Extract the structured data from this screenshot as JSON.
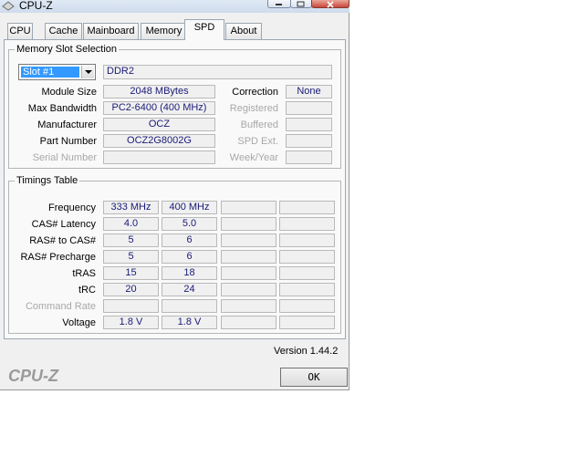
{
  "window": {
    "title": "CPU-Z"
  },
  "tabs": [
    "CPU",
    "Cache",
    "Mainboard",
    "Memory",
    "SPD",
    "About"
  ],
  "active_tab": "SPD",
  "slot": {
    "group_title": "Memory Slot Selection",
    "selected": "Slot #1",
    "type": "DDR2",
    "module_size_label": "Module Size",
    "module_size": "2048 MBytes",
    "max_bandwidth_label": "Max Bandwidth",
    "max_bandwidth": "PC2-6400 (400 MHz)",
    "manufacturer_label": "Manufacturer",
    "manufacturer": "OCZ",
    "part_number_label": "Part Number",
    "part_number": "OCZ2G8002G",
    "serial_number_label": "Serial Number",
    "serial_number": "",
    "correction_label": "Correction",
    "correction": "None",
    "registered_label": "Registered",
    "registered": "",
    "buffered_label": "Buffered",
    "buffered": "",
    "spd_ext_label": "SPD Ext.",
    "spd_ext": "",
    "week_year_label": "Week/Year",
    "week_year": ""
  },
  "timings": {
    "group_title": "Timings Table",
    "rows": [
      {
        "label": "Frequency",
        "values": [
          "333 MHz",
          "400 MHz",
          "",
          ""
        ]
      },
      {
        "label": "CAS# Latency",
        "values": [
          "4.0",
          "5.0",
          "",
          ""
        ]
      },
      {
        "label": "RAS# to CAS#",
        "values": [
          "5",
          "6",
          "",
          ""
        ]
      },
      {
        "label": "RAS# Precharge",
        "values": [
          "5",
          "6",
          "",
          ""
        ]
      },
      {
        "label": "tRAS",
        "values": [
          "15",
          "18",
          "",
          ""
        ]
      },
      {
        "label": "tRC",
        "values": [
          "20",
          "24",
          "",
          ""
        ]
      },
      {
        "label": "Command Rate",
        "values": [
          "",
          "",
          "",
          ""
        ],
        "disabled": true
      },
      {
        "label": "Voltage",
        "values": [
          "1.8 V",
          "1.8 V",
          "",
          ""
        ]
      }
    ]
  },
  "footer": {
    "version": "Version 1.44.2",
    "brand": "CPU-Z",
    "ok_label": "OK"
  }
}
